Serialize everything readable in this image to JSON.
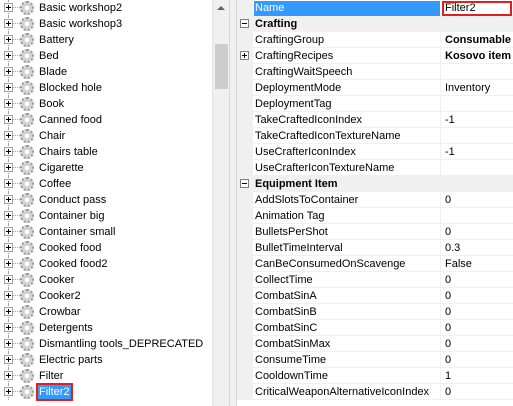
{
  "tree": {
    "items": [
      {
        "label": "Basic workshop2"
      },
      {
        "label": "Basic workshop3"
      },
      {
        "label": "Battery"
      },
      {
        "label": "Bed"
      },
      {
        "label": "Blade"
      },
      {
        "label": "Blocked hole"
      },
      {
        "label": "Book"
      },
      {
        "label": "Canned food"
      },
      {
        "label": "Chair"
      },
      {
        "label": "Chairs table"
      },
      {
        "label": "Cigarette"
      },
      {
        "label": "Coffee"
      },
      {
        "label": "Conduct pass"
      },
      {
        "label": "Container big"
      },
      {
        "label": "Container small"
      },
      {
        "label": "Cooked food"
      },
      {
        "label": "Cooked food2"
      },
      {
        "label": "Cooker"
      },
      {
        "label": "Cooker2"
      },
      {
        "label": "Crowbar"
      },
      {
        "label": "Detergents"
      },
      {
        "label": "Dismantling tools_DEPRECATED"
      },
      {
        "label": "Electric parts"
      },
      {
        "label": "Filter"
      },
      {
        "label": "Filter2",
        "selected": true
      }
    ]
  },
  "grid": {
    "header": {
      "name": "Name",
      "value": "Filter2"
    },
    "categories": [
      {
        "title": "Crafting",
        "rows": [
          {
            "name": "CraftingGroup",
            "value": "Consumable",
            "bold": true
          },
          {
            "name": "CraftingRecipes",
            "value": "Kosovo item",
            "bold": true,
            "expandable": true
          },
          {
            "name": "CraftingWaitSpeech",
            "value": ""
          },
          {
            "name": "DeploymentMode",
            "value": "Inventory"
          },
          {
            "name": "DeploymentTag",
            "value": ""
          },
          {
            "name": "TakeCraftedIconIndex",
            "value": "-1"
          },
          {
            "name": "TakeCraftedIconTextureName",
            "value": ""
          },
          {
            "name": "UseCrafterIconIndex",
            "value": "-1"
          },
          {
            "name": "UseCrafterIconTextureName",
            "value": ""
          }
        ]
      },
      {
        "title": "Equipment Item",
        "rows": [
          {
            "name": "AddSlotsToContainer",
            "value": "0"
          },
          {
            "name": "Animation Tag",
            "value": ""
          },
          {
            "name": "BulletsPerShot",
            "value": "0"
          },
          {
            "name": "BulletTimeInterval",
            "value": "0.3"
          },
          {
            "name": "CanBeConsumedOnScavenge",
            "value": "False"
          },
          {
            "name": "CollectTime",
            "value": "0"
          },
          {
            "name": "CombatSinA",
            "value": "0"
          },
          {
            "name": "CombatSinB",
            "value": "0"
          },
          {
            "name": "CombatSinC",
            "value": "0"
          },
          {
            "name": "CombatSinMax",
            "value": "0"
          },
          {
            "name": "ConsumeTime",
            "value": "0"
          },
          {
            "name": "CooldownTime",
            "value": "1"
          },
          {
            "name": "CriticalWeaponAlternativeIconIndex",
            "value": "0"
          }
        ]
      }
    ]
  }
}
